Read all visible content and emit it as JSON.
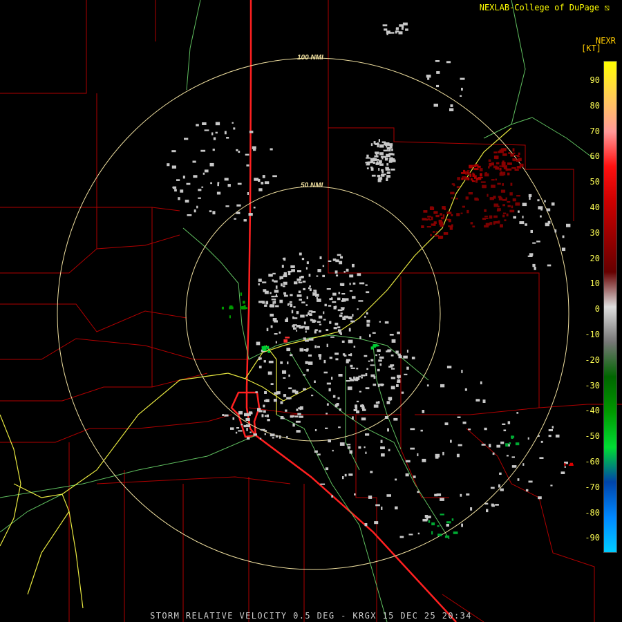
{
  "header": {
    "credit": "NEXLAB-College of DuPage",
    "product": "NEXR",
    "units": "[KT]"
  },
  "range_rings": {
    "inner_label": "50 NMI",
    "outer_label": "100 NMI",
    "color": "#f0e0a0"
  },
  "legend": {
    "labels": [
      "90",
      "80",
      "70",
      "60",
      "50",
      "40",
      "30",
      "20",
      "10",
      "0",
      "-10",
      "-20",
      "-30",
      "-40",
      "-50",
      "-60",
      "-70",
      "-80",
      "-90"
    ],
    "stops": [
      {
        "color": "#ffff00"
      },
      {
        "color": "#ffcc55"
      },
      {
        "color": "#ff9999"
      },
      {
        "color": "#ff1010"
      },
      {
        "color": "#cc0000"
      },
      {
        "color": "#990000"
      },
      {
        "color": "#660000"
      },
      {
        "color": "#dddddd"
      },
      {
        "color": "#777777"
      },
      {
        "color": "#006600"
      },
      {
        "color": "#009900"
      },
      {
        "color": "#00dd33"
      },
      {
        "color": "#0044aa"
      },
      {
        "color": "#0088ff"
      },
      {
        "color": "#00ccff"
      }
    ]
  },
  "footer": {
    "text": "STORM RELATIVE VELOCITY 0.5 DEG - KRGX 15 DEC 25 20:34"
  },
  "colors": {
    "county_lines": "#b00000",
    "state_lines": "#ff2020",
    "highways": "#e8e840",
    "roads": "#60c060",
    "echo_gray": "#c8c8c8"
  }
}
